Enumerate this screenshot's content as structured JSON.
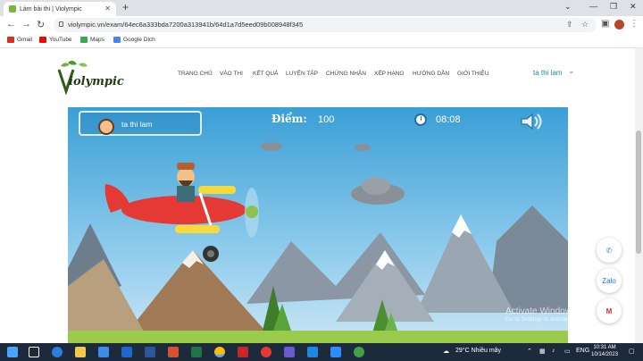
{
  "browser": {
    "tab_title": "Làm bài thi | Violympic",
    "url": "violympic.vn/exam/64ec6a333bda7200a313941b/64d1a7d5eed09b008948f345",
    "bookmarks": [
      {
        "label": "Gmail",
        "color": "#d93025"
      },
      {
        "label": "YouTube",
        "color": "#ff0000"
      },
      {
        "label": "Maps",
        "color": "#34a853"
      },
      {
        "label": "Google Dịch",
        "color": "#4285f4"
      }
    ]
  },
  "site": {
    "logo_text": "iolympic",
    "menu": [
      "TRANG CHỦ",
      "VÀO THI",
      "KẾT QUẢ",
      "LUYỆN TẬP",
      "CHỨNG NHẬN",
      "XẾP HẠNG",
      "HƯỚNG DẪN",
      "GIỚI THIỆU"
    ],
    "user_name": "ta thi lam"
  },
  "game": {
    "player_name": "ta thi lam",
    "score_label": "Điểm:",
    "score_value": "100",
    "timer": "08:08",
    "sky_color": "#3a9fd6",
    "plane_color": "#e53935"
  },
  "floating": {
    "phone_icon": "phone-icon",
    "zalo_label": "Zalo",
    "gmail_icon": "gmail-icon"
  },
  "watermark": {
    "line1": "Activate Windows",
    "line2": "Go to Settings to activate Windows."
  },
  "taskbar": {
    "weather": "29°C  Nhiều mây",
    "lang": "ENG",
    "time": "10:31 AM",
    "date": "10/14/2023"
  }
}
